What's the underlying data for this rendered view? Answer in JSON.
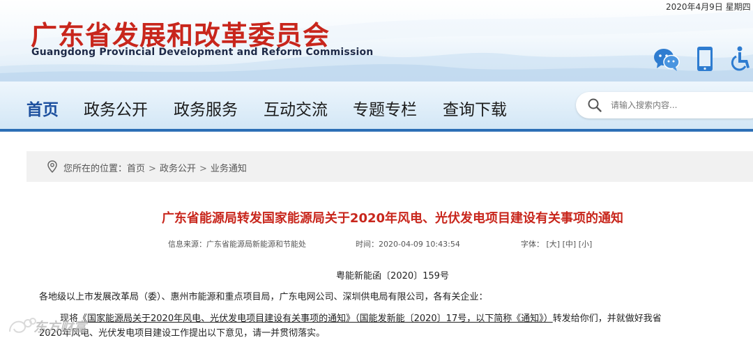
{
  "header": {
    "date": "2020年4月9日   星期四",
    "title": "广东省发展和改革委员会",
    "subtitle": "Guangdong Provincial Development and Reform Commission",
    "icons": [
      "wechat-icon",
      "mobile-icon",
      "accessibility-icon"
    ]
  },
  "nav": {
    "items": [
      {
        "label": "首页",
        "active": true
      },
      {
        "label": "政务公开"
      },
      {
        "label": "政务服务"
      },
      {
        "label": "互动交流"
      },
      {
        "label": "专题专栏"
      },
      {
        "label": "查询下载"
      }
    ],
    "search": {
      "placeholder": "请输入搜索内容..."
    }
  },
  "breadcrumb": {
    "prefix": "您所在的位置：",
    "items": [
      "首页",
      "政务公开",
      "业务通知"
    ],
    "separator": ">"
  },
  "article": {
    "title": "广东省能源局转发国家能源局关于2020年风电、光伏发电项目建设有关事项的通知",
    "source": "信息来源：广东省能源局新能源和节能处",
    "time": "时间：2020-04-09 10:43:54",
    "font_label": "字体：",
    "font_sizes": [
      "[大]",
      "[中]",
      "[小]"
    ],
    "doc_number": "粤能新能函〔2020〕159号",
    "para1": "各地级以上市发展改革局（委）、惠州市能源和重点项目局，广东电网公司、深圳供电局有限公司，各有关企业：",
    "para2_prefix": "现将",
    "para2_link": "《国家能源局关于2020年风电、光伏发电项目建设有关事项的通知》（国能发新能〔2020〕17号，以下简称《通知》）",
    "para2_suffix": "转发给你们，并就做好我省",
    "para3": "2020年风电、光伏发电项目建设工作提出以下意见，请一并贯彻落实。"
  },
  "watermark": {
    "text": "东方财富"
  },
  "colors": {
    "title_red": "#c8261c",
    "nav_active": "#1c4f9e",
    "nav_border": "#2d6fb6",
    "breadcrumb_bg": "#f1f1f1"
  }
}
